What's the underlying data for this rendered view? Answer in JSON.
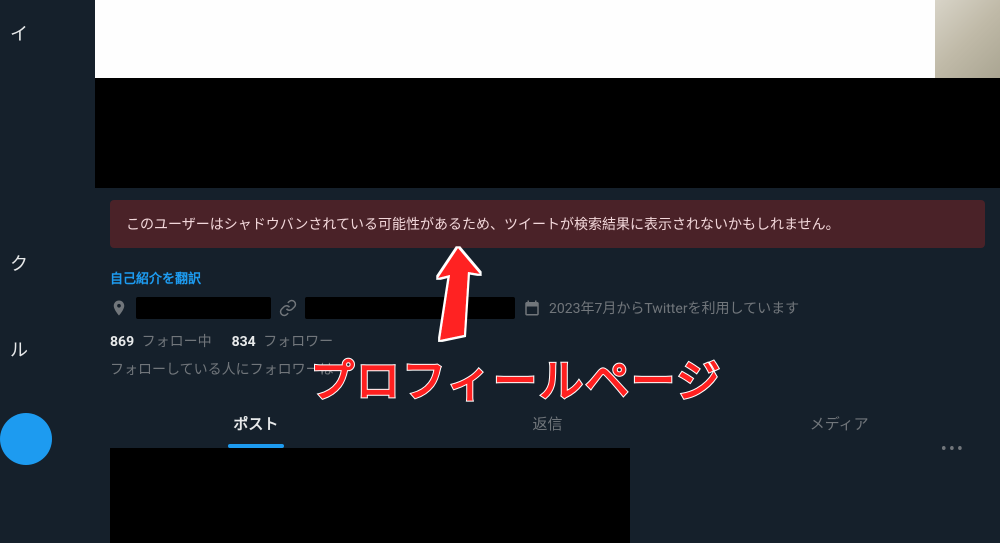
{
  "sidebar": {
    "items": [
      "イ",
      "ク",
      "ル"
    ]
  },
  "warning": {
    "text": "このユーザーはシャドウバンされている可能性があるため、ツイートが検索結果に表示されないかもしれません。"
  },
  "profile": {
    "translate_bio": "自己紹介を翻訳",
    "joined": "2023年7月からTwitterを利用しています",
    "following_count": "869",
    "following_label": "フォロー中",
    "followers_count": "834",
    "followers_label": "フォロワー",
    "followers_note": "フォローしている人にフォロワーは"
  },
  "tabs": {
    "posts": "ポスト",
    "replies": "返信",
    "media": "メディア"
  },
  "more": "•••",
  "annotation": {
    "text": "プロフィールページ"
  }
}
